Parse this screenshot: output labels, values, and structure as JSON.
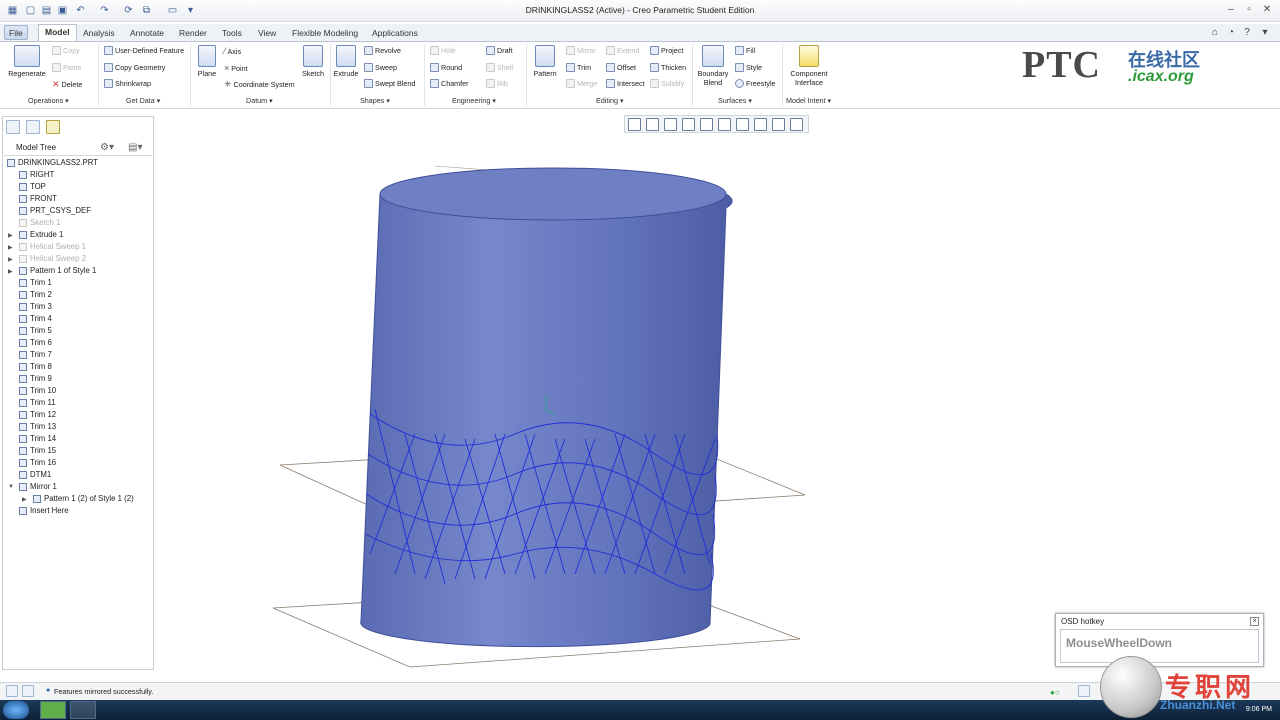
{
  "window": {
    "title": "DRINKINGLASS2 (Active) - Creo Parametric Student Edition"
  },
  "tabs": [
    "File",
    "Model",
    "Analysis",
    "Annotate",
    "Render",
    "Tools",
    "View",
    "Flexible Modeling",
    "Applications"
  ],
  "active_tab": "Model",
  "ribbon": {
    "regenerate": "Regenerate",
    "operations_items": [
      "Copy",
      "Paste",
      "Delete"
    ],
    "getdata_items": [
      "User-Defined Feature",
      "Copy Geometry",
      "Shrinkwrap"
    ],
    "plane": "Plane",
    "datum_items": [
      "Axis",
      "Point",
      "Coordinate System"
    ],
    "sketch": "Sketch",
    "extrude": "Extrude",
    "shapes_items": [
      "Revolve",
      "Sweep",
      "Swept Blend"
    ],
    "engineering_col1": [
      "Hole",
      "Round",
      "Chamfer"
    ],
    "engineering_col2": [
      "Draft",
      "Shell",
      "Rib"
    ],
    "pattern": "Pattern",
    "editing_col1": [
      "Mirror",
      "Trim",
      "Merge"
    ],
    "editing_col2": [
      "Extend",
      "Offset",
      "Intersect"
    ],
    "editing_col3": [
      "Project",
      "Thicken",
      "Solidify"
    ],
    "boundary_blend": [
      "Boundary",
      "Blend"
    ],
    "surfaces_items": [
      "Fill",
      "Style",
      "Freestyle"
    ],
    "component_interface": [
      "Component",
      "Interface"
    ],
    "groups": [
      "Operations",
      "Get Data",
      "Datum",
      "Shapes",
      "Engineering",
      "Editing",
      "Surfaces",
      "Model Intent"
    ]
  },
  "logo": {
    "brand": "PTC",
    "community": "在线社区",
    "url": ".icax.org"
  },
  "model_tree": {
    "header": "Model Tree",
    "items": [
      {
        "label": "DRINKINGLASS2.PRT",
        "disabled": false
      },
      {
        "label": "RIGHT",
        "disabled": false
      },
      {
        "label": "TOP",
        "disabled": false
      },
      {
        "label": "FRONT",
        "disabled": false
      },
      {
        "label": "PRT_CSYS_DEF",
        "disabled": false
      },
      {
        "label": "Sketch 1",
        "disabled": true
      },
      {
        "label": "Extrude 1",
        "disabled": false
      },
      {
        "label": "Helical Sweep 1",
        "disabled": true
      },
      {
        "label": "Helical Sweep 2",
        "disabled": true
      },
      {
        "label": "Pattern 1 of Style 1",
        "disabled": false
      },
      {
        "label": "Trim 1",
        "disabled": false
      },
      {
        "label": "Trim 2",
        "disabled": false
      },
      {
        "label": "Trim 3",
        "disabled": false
      },
      {
        "label": "Trim 4",
        "disabled": false
      },
      {
        "label": "Trim 5",
        "disabled": false
      },
      {
        "label": "Trim 6",
        "disabled": false
      },
      {
        "label": "Trim 7",
        "disabled": false
      },
      {
        "label": "Trim 8",
        "disabled": false
      },
      {
        "label": "Trim 9",
        "disabled": false
      },
      {
        "label": "Trim 10",
        "disabled": false
      },
      {
        "label": "Trim 11",
        "disabled": false
      },
      {
        "label": "Trim 12",
        "disabled": false
      },
      {
        "label": "Trim 13",
        "disabled": false
      },
      {
        "label": "Trim 14",
        "disabled": false
      },
      {
        "label": "Trim 15",
        "disabled": false
      },
      {
        "label": "Trim 16",
        "disabled": false
      },
      {
        "label": "DTM1",
        "disabled": false
      },
      {
        "label": "Mirror 1",
        "disabled": false
      },
      {
        "label": "Pattern 1 (2) of Style 1 (2)",
        "disabled": false
      },
      {
        "label": "Insert Here",
        "disabled": false
      }
    ]
  },
  "osd": {
    "title": "OSD hotkey",
    "value": "MouseWheelDown"
  },
  "status": {
    "message": "Features mirrored successfully."
  },
  "taskbar": {
    "clock": "9:06 PM"
  },
  "watermark": {
    "cn": "专职网",
    "url": "Zhuanzhi.Net"
  },
  "colors": {
    "accent": "#5a6fb8",
    "surface": "#6e7fc4",
    "mesh": "#1f2fd6"
  }
}
